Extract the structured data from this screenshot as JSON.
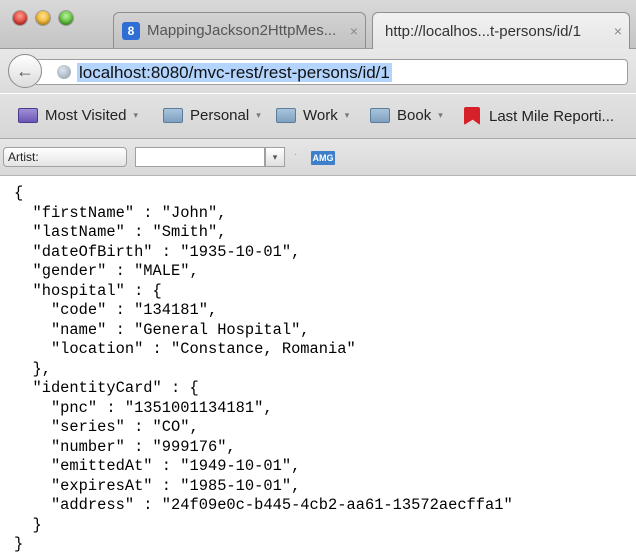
{
  "tabs": [
    {
      "favicon": "8",
      "label": "MappingJackson2HttpMes...",
      "close": "×"
    },
    {
      "label": "http://localhos...t-persons/id/1",
      "close": "×"
    }
  ],
  "nav": {
    "back_icon": "back-arrow-icon",
    "back_glyph": "←",
    "url": "localhost:8080/mvc-rest/rest-persons/id/1"
  },
  "bookmarks": [
    {
      "label": "Most Visited",
      "chevron": "▾"
    },
    {
      "label": "Personal",
      "chevron": "▾"
    },
    {
      "label": "Work",
      "chevron": "▾"
    },
    {
      "label": "Book",
      "chevron": "▾"
    },
    {
      "label": "Last Mile Reporti..."
    }
  ],
  "toolbar": {
    "artist_label": "Artist:",
    "search_value": "",
    "dropdown_glyph": "▾",
    "amg_label": "AMG"
  },
  "json_lines": [
    "{",
    "  \"firstName\" : \"John\",",
    "  \"lastName\" : \"Smith\",",
    "  \"dateOfBirth\" : \"1935-10-01\",",
    "  \"gender\" : \"MALE\",",
    "  \"hospital\" : {",
    "    \"code\" : \"134181\",",
    "    \"name\" : \"General Hospital\",",
    "    \"location\" : \"Constance, Romania\"",
    "  },",
    "  \"identityCard\" : {",
    "    \"pnc\" : \"1351001134181\",",
    "    \"series\" : \"CO\",",
    "    \"number\" : \"999176\",",
    "    \"emittedAt\" : \"1949-10-01\",",
    "    \"expiresAt\" : \"1985-10-01\",",
    "    \"address\" : \"24f09e0c-b445-4cb2-aa61-13572aecffa1\"",
    "  }",
    "}"
  ],
  "colors": {
    "url_highlight": "#b3d4fc",
    "close": "#e0443a",
    "minimize": "#f0b733",
    "zoom": "#5dbf3a"
  }
}
